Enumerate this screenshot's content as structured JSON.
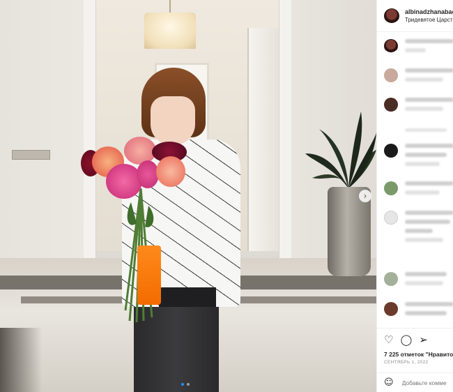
{
  "post": {
    "username": "albinadzhanabae",
    "location": "Тридевятое Царств",
    "likes_text": "7 225 отметок \"Нравито",
    "date": "СЕНТЯБРЬ 1, 2022",
    "comment_placeholder": "Добавьте комме"
  },
  "icons": {
    "like": "heart-icon",
    "comment": "speech-bubble-icon",
    "share": "paper-plane-icon",
    "emoji": "smiley-icon",
    "carousel_next": "chevron-right-icon"
  },
  "glyphs": {
    "like": "♡",
    "comment": "◯",
    "share": "➢",
    "emoji": "☺",
    "next": "›"
  },
  "colors": {
    "accent": "#1e90ff",
    "muted": "#8e8e8e",
    "text": "#262626"
  },
  "carousel": {
    "slide_count": 2,
    "active_index": 0
  }
}
